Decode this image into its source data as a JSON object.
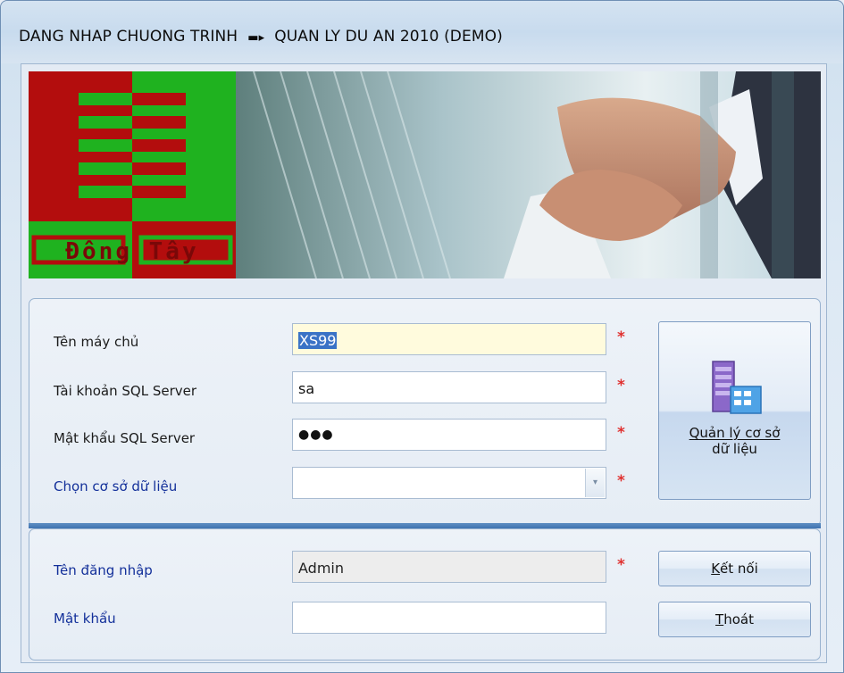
{
  "window": {
    "title_left": "DANG NHAP CHUONG TRINH",
    "title_arrow": "▬▸",
    "title_right": "QUAN LY DU AN 2010 (DEMO)"
  },
  "banner": {
    "logo_text": "Đông Tây"
  },
  "server_section": {
    "server_name": {
      "label": "Tên máy chủ",
      "value": "XS99"
    },
    "sql_account": {
      "label": "Tài khoản SQL Server",
      "value": "sa"
    },
    "sql_password": {
      "label": "Mật khẩu SQL Server",
      "value": "●●●"
    },
    "database": {
      "label": "Chọn cơ sở dữ liệu",
      "value": ""
    },
    "required_mark": "*",
    "db_manage_button": {
      "line1": "Quản lý cơ sở",
      "line2": "dữ liệu"
    }
  },
  "login_section": {
    "username": {
      "label": "Tên đăng nhập",
      "value": "Admin"
    },
    "password": {
      "label": "Mật khẩu",
      "value": ""
    },
    "connect_button": {
      "mnemonic": "K",
      "rest": "ết nối"
    },
    "exit_button": {
      "mnemonic": "T",
      "rest": "hoát"
    }
  },
  "colors": {
    "logo_red": "#b30d0d",
    "logo_green": "#1fb21f",
    "required": "#e0302f",
    "blue_label": "#13309a",
    "selection": "#3a73c6"
  }
}
